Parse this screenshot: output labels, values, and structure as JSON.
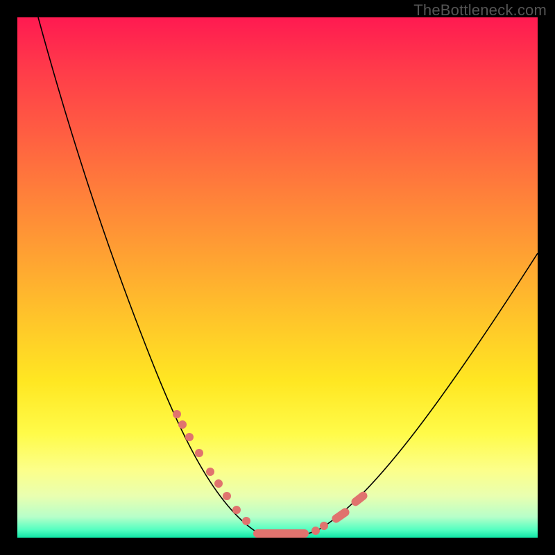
{
  "watermark": "TheBottleneck.com",
  "chart_data": {
    "type": "line",
    "title": "",
    "xlabel": "",
    "ylabel": "",
    "xlim": [
      0,
      100
    ],
    "ylim": [
      0,
      100
    ],
    "grid": false,
    "series": [
      {
        "name": "curve",
        "x": [
          4,
          8,
          12,
          16,
          20,
          24,
          28,
          32,
          36,
          40,
          42,
          44,
          46,
          48,
          50,
          52,
          54,
          56,
          58,
          60,
          64,
          70,
          76,
          82,
          88,
          94,
          100
        ],
        "y": [
          100,
          92,
          83,
          74,
          65,
          56,
          47,
          38,
          29,
          20,
          15,
          11,
          7,
          4,
          2,
          1,
          0.5,
          0.5,
          1,
          2,
          5,
          12,
          20,
          29,
          38,
          47,
          55
        ]
      }
    ],
    "markers": {
      "points_x": [
        30.5,
        31.5,
        33,
        35,
        37.5,
        39,
        42,
        44,
        46,
        48,
        50,
        51.5,
        53,
        56.5,
        59.5,
        60.5,
        62,
        63.5
      ],
      "points_y": [
        24,
        22,
        19,
        15,
        11,
        9,
        5,
        3,
        1.5,
        0.8,
        0.5,
        0.5,
        0.5,
        1,
        3,
        4,
        5.5,
        8
      ],
      "color": "#e0736e"
    }
  }
}
